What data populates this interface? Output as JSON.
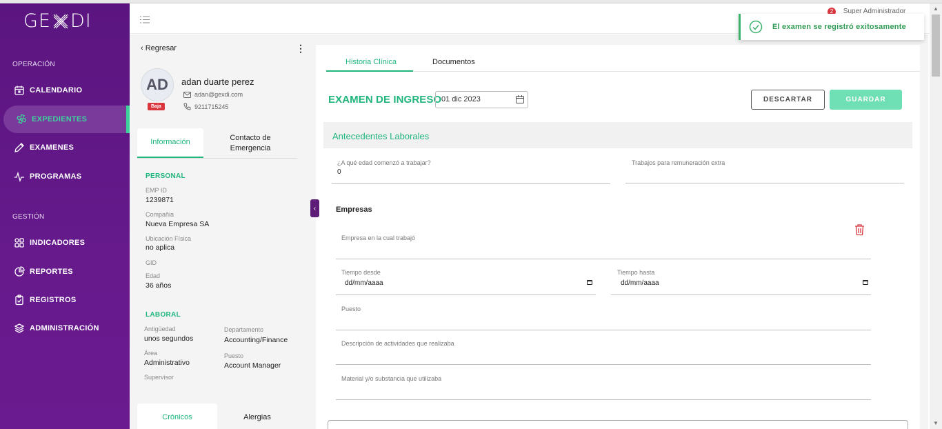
{
  "colors": {
    "sidebar": "#661a8c",
    "accent": "#20b57d",
    "danger": "#d9363e",
    "save_button": "#6fe0b5"
  },
  "app": {
    "logo": "GEXDI"
  },
  "sidebar": {
    "section_operacion": "OPERACIÓN",
    "section_gestion": "GESTIÓN",
    "items": [
      {
        "label": "CALENDARIO",
        "icon": "calendar-icon"
      },
      {
        "label": "EXPEDIENTES",
        "icon": "medical-icon",
        "active": true
      },
      {
        "label": "EXAMENES",
        "icon": "pencil-icon"
      },
      {
        "label": "PROGRAMAS",
        "icon": "pulse-icon"
      },
      {
        "label": "INDICADORES",
        "icon": "grid-icon"
      },
      {
        "label": "REPORTES",
        "icon": "pie-chart-icon"
      },
      {
        "label": "REGISTROS",
        "icon": "clipboard-icon"
      },
      {
        "label": "ADMINISTRACIÓN",
        "icon": "layers-icon"
      }
    ]
  },
  "header": {
    "user": "Super Administrador",
    "notifications": "2"
  },
  "toast": {
    "message": "El examen se registró exitosamente"
  },
  "patient": {
    "back": "Regresar",
    "initials": "AD",
    "status": "Baja",
    "name": "adan duarte perez",
    "email": "adan@gexdi.com",
    "phone": "9211715245",
    "tabs": [
      "Información",
      "Contacto de Emergencia"
    ],
    "personal_title": "PERSONAL",
    "emp_id_label": "EMP ID",
    "emp_id": "1239871",
    "company_label": "Compañia",
    "company": "Nueva Empresa SA",
    "location_label": "Ubicación Física",
    "location": "no aplica",
    "gid_label": "GID",
    "age_label": "Edad",
    "age": "36 años",
    "laboral_title": "LABORAL",
    "antiguedad_label": "Antigüedad",
    "antiguedad": "unos segundos",
    "area_label": "Área",
    "area": "Administrativo",
    "supervisor_label": "Supervisor",
    "depto_label": "Departamento",
    "depto": "Accounting/Finance",
    "puesto_label": "Puesto",
    "puesto": "Account Manager",
    "bottom_tabs": [
      "Crónicos",
      "Alergias"
    ]
  },
  "main": {
    "tabs": [
      "Historia Clínica",
      "Documentos"
    ],
    "title": "EXAMEN DE INGRESO",
    "date": "01 dic 2023",
    "discard": "DESCARTAR",
    "save": "GUARDAR",
    "section": "Antecedentes Laborales",
    "q_age_label": "¿A qué edad comenzó a trabajar?",
    "q_age_value": "0",
    "q_extra_label": "Trabajos para remuneración extra",
    "empresas_title": "Empresas",
    "empresa_label": "Empresa en la cual trabajó",
    "desde_label": "Tiempo desde",
    "hasta_label": "Tiempo hasta",
    "date_placeholder": "dd/mm/aaaa",
    "puesto_label": "Puesto",
    "actividades_label": "Descripción de actividades que realizaba",
    "material_label": "Material y/o substancia que utilizaba"
  }
}
